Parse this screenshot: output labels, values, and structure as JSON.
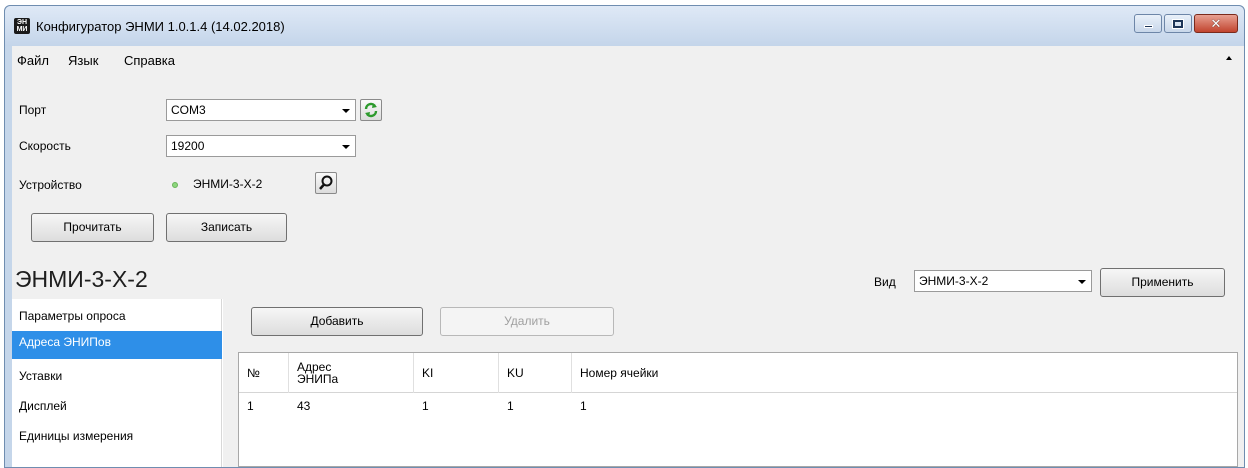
{
  "window": {
    "app_icon_text": "ЭН МИ",
    "title": "Конфигуратор ЭНМИ 1.0.1.4 (14.02.2018)"
  },
  "menu": [
    "Файл",
    "Язык",
    "Справка"
  ],
  "connection": {
    "port_label": "Порт",
    "port_value": "COM3",
    "speed_label": "Скорость",
    "speed_value": "19200",
    "device_label": "Устройство",
    "device_value": "ЭНМИ-3-Х-2",
    "device_status_color": "#8cd67c"
  },
  "actions": {
    "read_label": "Прочитать",
    "write_label": "Записать"
  },
  "device_panel": {
    "title": "ЭНМИ-3-Х-2",
    "view_label": "Вид",
    "view_value": "ЭНМИ-3-Х-2",
    "apply_label": "Применить"
  },
  "sidebar": {
    "items": [
      "Параметры опроса",
      "Адреса ЭНИПов",
      "Уставки",
      "Дисплей",
      "Единицы измерения"
    ],
    "selected_index": 1,
    "selected_color": "#2e8fe8"
  },
  "toolbar": {
    "add_label": "Добавить",
    "delete_label": "Удалить"
  },
  "table": {
    "columns": [
      "№",
      "Адрес ЭНИПа",
      "KI",
      "KU",
      "Номер ячейки"
    ],
    "rows": [
      [
        "1",
        "43",
        "1",
        "1",
        "1"
      ]
    ]
  }
}
